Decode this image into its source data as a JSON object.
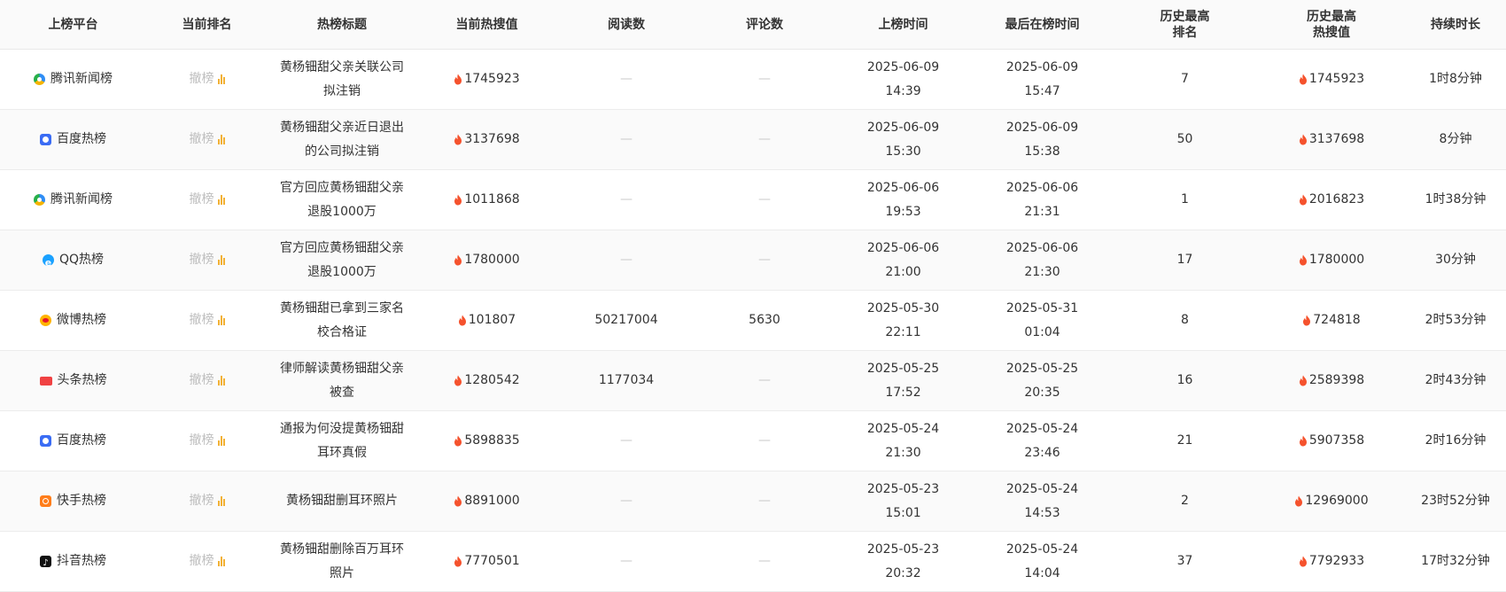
{
  "colors": {
    "accent_flame": "#f5522d",
    "rank_bar": "#f2b135",
    "muted_text": "#bdbdbd",
    "header_bg": "#fafafa"
  },
  "table": {
    "headers": {
      "platform": "上榜平台",
      "current_rank": "当前排名",
      "title": "热榜标题",
      "current_hot": "当前热搜值",
      "reads": "阅读数",
      "comments": "评论数",
      "start_time": "上榜时间",
      "last_time": "最后在榜时间",
      "best_rank_l1": "历史最高",
      "best_rank_l2": "排名",
      "best_hot_l1": "历史最高",
      "best_hot_l2": "热搜值",
      "duration": "持续时长"
    },
    "rows": [
      {
        "platform": "腾讯新闻榜",
        "platform_icon": "tencent-news-icon",
        "status": "撤榜",
        "title": "黄杨钿甜父亲关联公司拟注销",
        "hot": "1745923",
        "reads": "—",
        "comments": "—",
        "start_date": "2025-06-09",
        "start_clock": "14:39",
        "last_date": "2025-06-09",
        "last_clock": "15:47",
        "best_rank": "7",
        "best_hot": "1745923",
        "duration": "1时8分钟"
      },
      {
        "platform": "百度热榜",
        "platform_icon": "baidu-icon",
        "status": "撤榜",
        "title": "黄杨钿甜父亲近日退出的公司拟注销",
        "hot": "3137698",
        "reads": "—",
        "comments": "—",
        "start_date": "2025-06-09",
        "start_clock": "15:30",
        "last_date": "2025-06-09",
        "last_clock": "15:38",
        "best_rank": "50",
        "best_hot": "3137698",
        "duration": "8分钟"
      },
      {
        "platform": "腾讯新闻榜",
        "platform_icon": "tencent-news-icon",
        "status": "撤榜",
        "title": "官方回应黄杨钿甜父亲退股1000万",
        "hot": "1011868",
        "reads": "—",
        "comments": "—",
        "start_date": "2025-06-06",
        "start_clock": "19:53",
        "last_date": "2025-06-06",
        "last_clock": "21:31",
        "best_rank": "1",
        "best_hot": "2016823",
        "duration": "1时38分钟"
      },
      {
        "platform": "QQ热榜",
        "platform_icon": "qq-icon",
        "status": "撤榜",
        "title": "官方回应黄杨钿甜父亲退股1000万",
        "hot": "1780000",
        "reads": "—",
        "comments": "—",
        "start_date": "2025-06-06",
        "start_clock": "21:00",
        "last_date": "2025-06-06",
        "last_clock": "21:30",
        "best_rank": "17",
        "best_hot": "1780000",
        "duration": "30分钟"
      },
      {
        "platform": "微博热榜",
        "platform_icon": "weibo-icon",
        "status": "撤榜",
        "title": "黄杨钿甜已拿到三家名校合格证",
        "hot": "101807",
        "reads": "50217004",
        "comments": "5630",
        "start_date": "2025-05-30",
        "start_clock": "22:11",
        "last_date": "2025-05-31",
        "last_clock": "01:04",
        "best_rank": "8",
        "best_hot": "724818",
        "duration": "2时53分钟"
      },
      {
        "platform": "头条热榜",
        "platform_icon": "toutiao-icon",
        "status": "撤榜",
        "title": "律师解读黄杨钿甜父亲被查",
        "hot": "1280542",
        "reads": "1177034",
        "comments": "—",
        "start_date": "2025-05-25",
        "start_clock": "17:52",
        "last_date": "2025-05-25",
        "last_clock": "20:35",
        "best_rank": "16",
        "best_hot": "2589398",
        "duration": "2时43分钟"
      },
      {
        "platform": "百度热榜",
        "platform_icon": "baidu-icon",
        "status": "撤榜",
        "title": "通报为何没提黄杨钿甜耳环真假",
        "hot": "5898835",
        "reads": "—",
        "comments": "—",
        "start_date": "2025-05-24",
        "start_clock": "21:30",
        "last_date": "2025-05-24",
        "last_clock": "23:46",
        "best_rank": "21",
        "best_hot": "5907358",
        "duration": "2时16分钟"
      },
      {
        "platform": "快手热榜",
        "platform_icon": "kuaishou-icon",
        "status": "撤榜",
        "title": "黄杨钿甜删耳环照片",
        "hot": "8891000",
        "reads": "—",
        "comments": "—",
        "start_date": "2025-05-23",
        "start_clock": "15:01",
        "last_date": "2025-05-24",
        "last_clock": "14:53",
        "best_rank": "2",
        "best_hot": "12969000",
        "duration": "23时52分钟"
      },
      {
        "platform": "抖音热榜",
        "platform_icon": "douyin-icon",
        "status": "撤榜",
        "title": "黄杨钿甜删除百万耳环照片",
        "hot": "7770501",
        "reads": "—",
        "comments": "—",
        "start_date": "2025-05-23",
        "start_clock": "20:32",
        "last_date": "2025-05-24",
        "last_clock": "14:04",
        "best_rank": "37",
        "best_hot": "7792933",
        "duration": "17时32分钟"
      }
    ]
  }
}
